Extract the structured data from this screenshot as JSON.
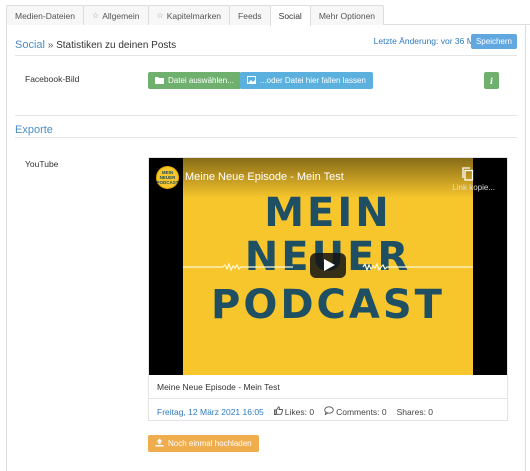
{
  "tabs": [
    {
      "label": "Medien-Dateien",
      "icon": ""
    },
    {
      "label": "Allgemein",
      "icon": "star-icon"
    },
    {
      "label": "Kapitelmarken",
      "icon": "star-icon"
    },
    {
      "label": "Feeds",
      "icon": ""
    },
    {
      "label": "Social",
      "icon": "",
      "active": true
    },
    {
      "label": "Mehr Optionen",
      "icon": ""
    }
  ],
  "header": {
    "crumb": "Social",
    "separator": "»",
    "title": "Statistiken zu deinen Posts",
    "last_change": "Letzte Änderung: vor 36 Minuten",
    "save_label": "Speichern"
  },
  "facebook": {
    "label": "Facebook-Bild",
    "choose_label": "Datei auswählen...",
    "drop_label": "...oder Datei hier fallen lassen",
    "info_label": "i"
  },
  "exports": {
    "heading": "Exporte",
    "youtube_label": "YouTube"
  },
  "video": {
    "channel_badge": "MEIN NEUER PODCAST",
    "title": "Meine Neue Episode - Mein Test",
    "copy_label": "Link kopie...",
    "thumb_lines": [
      "MEIN",
      "NEUER",
      "PODCAST"
    ],
    "caption": "Meine Neue Episode - Mein Test",
    "date": "Freitag, 12 März 2021 16:05",
    "likes": "Likes: 0",
    "comments": "Comments: 0",
    "shares": "Shares: 0"
  },
  "reupload_label": "Noch einmal hochladen",
  "colors": {
    "accent_blue": "#4a8ec7",
    "button_green": "#6fb06f",
    "button_blue": "#5bb0de",
    "button_orange": "#f0ad4e",
    "thumb_yellow": "#f7c52c",
    "thumb_text": "#1e4f63"
  }
}
